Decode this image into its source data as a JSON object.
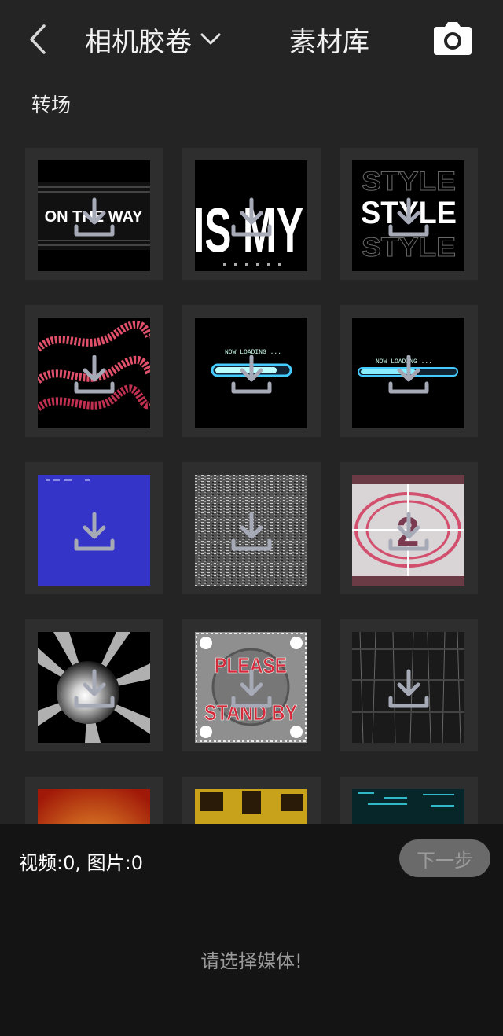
{
  "header": {
    "album_title": "相机胶卷",
    "library_title": "素材库"
  },
  "section": {
    "label": "转场"
  },
  "grid": {
    "items": [
      {
        "icon": "download-icon"
      },
      {
        "icon": "download-icon"
      },
      {
        "icon": "download-icon"
      },
      {
        "icon": "download-icon"
      },
      {
        "icon": "download-icon"
      },
      {
        "icon": "download-icon"
      },
      {
        "icon": "download-icon"
      },
      {
        "icon": "download-icon"
      },
      {
        "icon": "download-icon"
      },
      {
        "icon": "download-icon"
      },
      {
        "icon": "download-icon"
      },
      {
        "icon": "download-icon"
      },
      {
        "icon": "download-icon"
      },
      {
        "icon": "download-icon"
      },
      {
        "icon": "download-icon"
      }
    ],
    "thumbnail_text": {
      "on_the_way": "ON THE WAY",
      "is_my": "IS MY",
      "style": "STYLE",
      "now_loading_1": "NOW LOADING ...",
      "now_loading_2": "NOW LOADING ...",
      "countdown": "2",
      "please": "PLEASE",
      "stand_by": "STAND BY"
    }
  },
  "footer": {
    "selection_count": "视频:0, 图片:0",
    "next_button": "下一步",
    "empty_hint": "请选择媒体!"
  },
  "colors": {
    "background": "#242424",
    "panel": "#141414",
    "download_icon": "#a6a9b6",
    "disabled_button": "#6a6a6a"
  }
}
